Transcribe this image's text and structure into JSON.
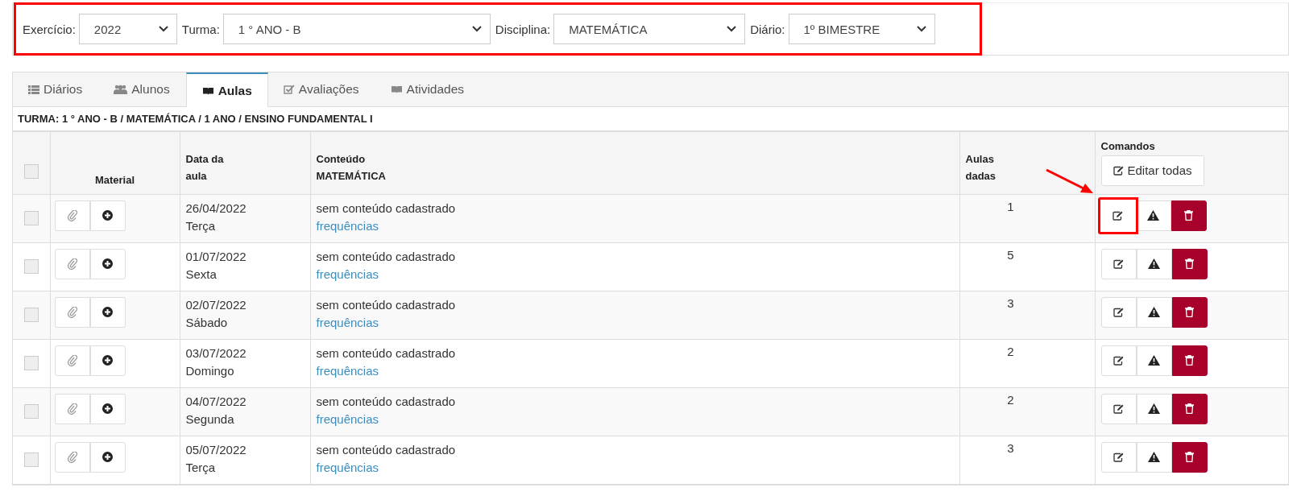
{
  "filters": [
    {
      "label": "Exercício:",
      "value": "2022"
    },
    {
      "label": "Turma:",
      "value": "1 ° ANO - B"
    },
    {
      "label": "Disciplina:",
      "value": "MATEMÁTICA"
    },
    {
      "label": "Diário:",
      "value": "1º BIMESTRE"
    }
  ],
  "tabs": [
    {
      "label": "Diários",
      "selected": false
    },
    {
      "label": "Alunos",
      "selected": false
    },
    {
      "label": "Aulas",
      "selected": true
    },
    {
      "label": "Avaliações",
      "selected": false
    },
    {
      "label": "Atividades",
      "selected": false
    }
  ],
  "class_title": "TURMA: 1 ° ANO - B / MATEMÁTICA / 1 ANO / ENSINO FUNDAMENTAL I",
  "table": {
    "columns": {
      "material": "Material",
      "date": "Data da aula",
      "content": "Conteúdo MATEMÁTICA",
      "lessons": "Aulas dadas",
      "commands": "Comandos"
    },
    "edit_all": "Editar todas",
    "select_all_checked": false,
    "rows": [
      {
        "checked": false,
        "date": "26/04/2022",
        "weekday": "Terça",
        "content": "sem conteúdo cadastrado",
        "link": "frequências",
        "lessons": "1",
        "highlighted": true
      },
      {
        "checked": false,
        "date": "01/07/2022",
        "weekday": "Sexta",
        "content": "sem conteúdo cadastrado",
        "link": "frequências",
        "lessons": "5",
        "highlighted": false
      },
      {
        "checked": false,
        "date": "02/07/2022",
        "weekday": "Sábado",
        "content": "sem conteúdo cadastrado",
        "link": "frequências",
        "lessons": "3",
        "highlighted": false
      },
      {
        "checked": false,
        "date": "03/07/2022",
        "weekday": "Domingo",
        "content": "sem conteúdo cadastrado",
        "link": "frequências",
        "lessons": "2",
        "highlighted": false
      },
      {
        "checked": false,
        "date": "04/07/2022",
        "weekday": "Segunda",
        "content": "sem conteúdo cadastrado",
        "link": "frequências",
        "lessons": "2",
        "highlighted": false
      },
      {
        "checked": false,
        "date": "05/07/2022",
        "weekday": "Terça",
        "content": "sem conteúdo cadastrado",
        "link": "frequências",
        "lessons": "3",
        "highlighted": false
      }
    ]
  }
}
